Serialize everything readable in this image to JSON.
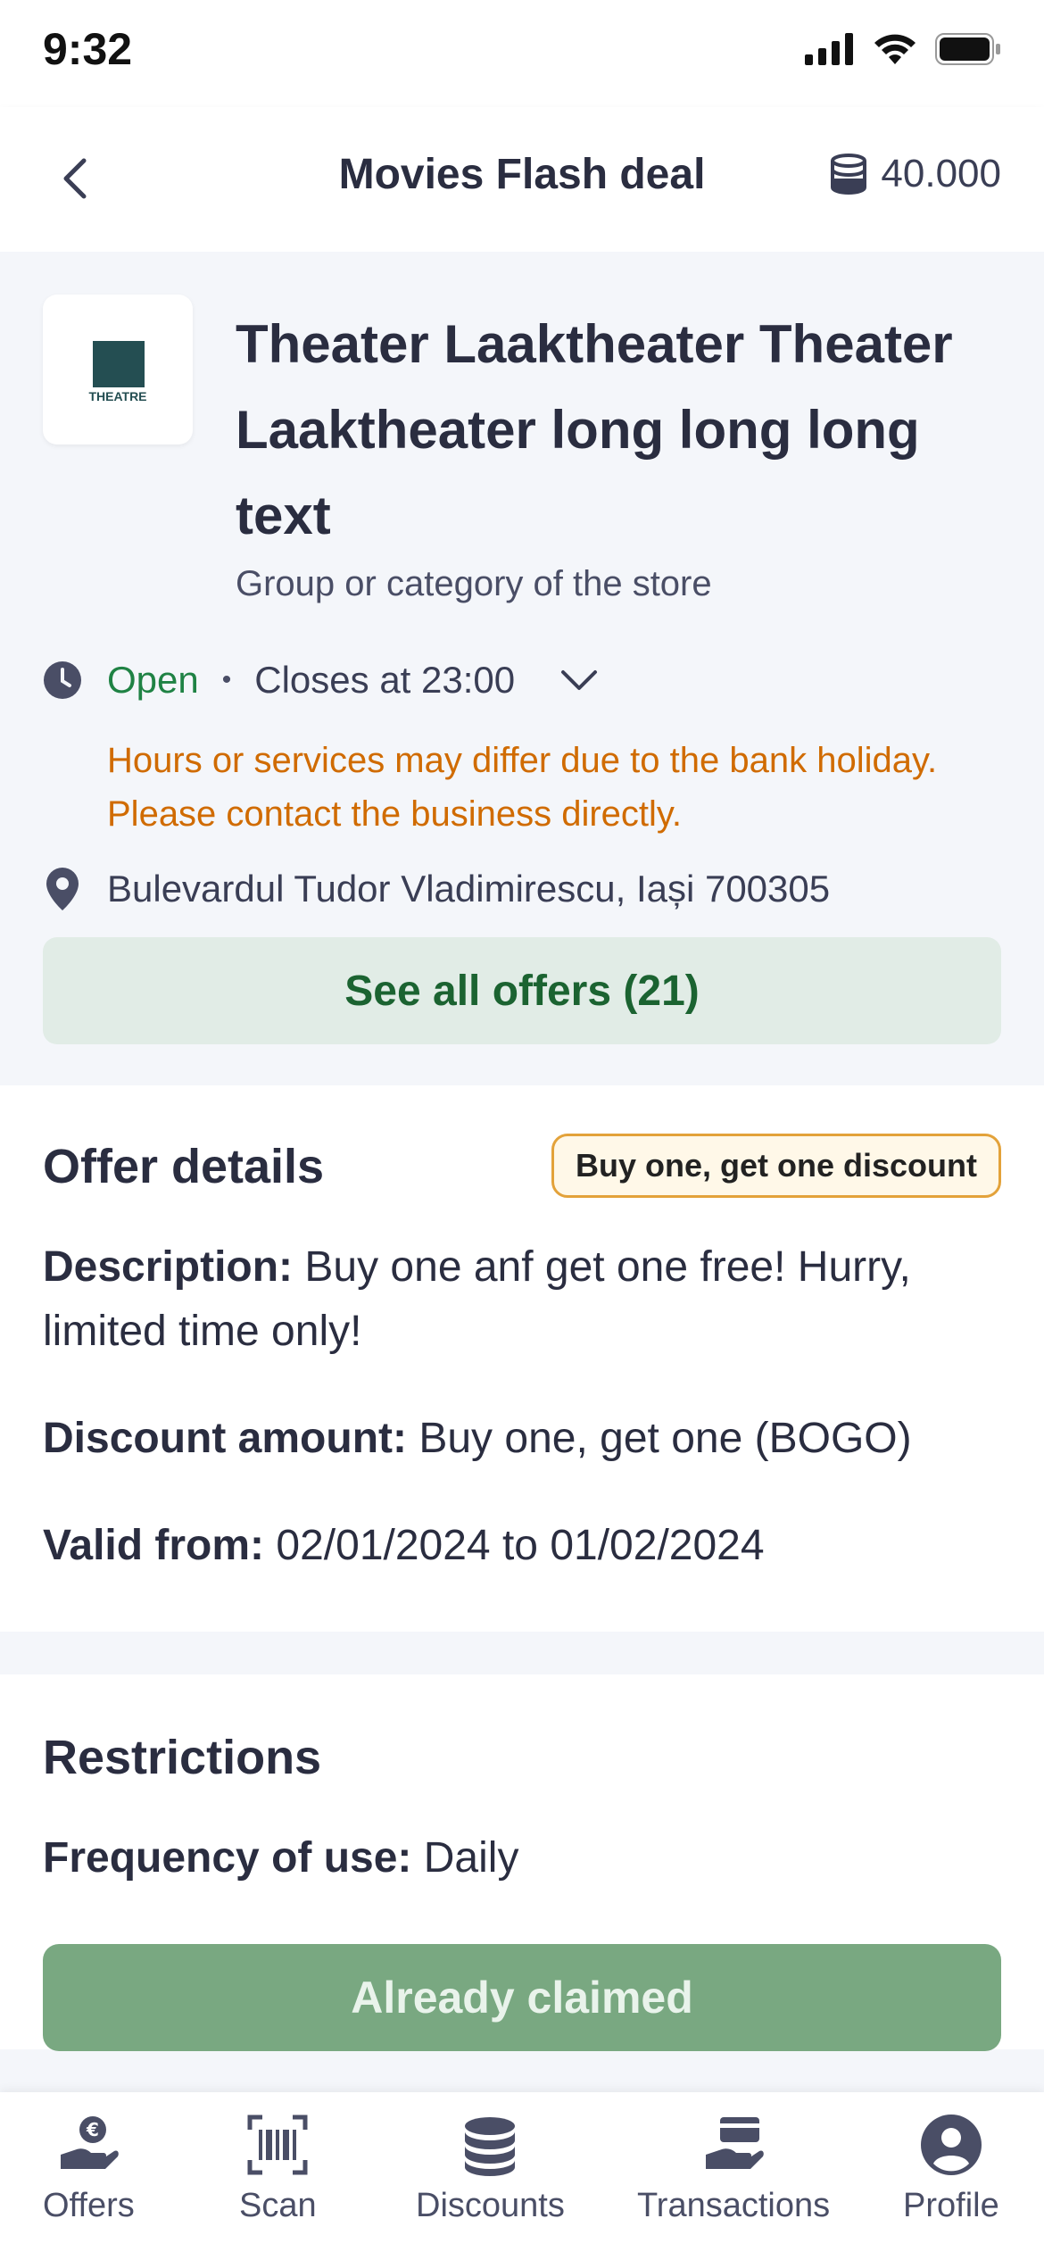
{
  "status_bar": {
    "time": "9:32"
  },
  "header": {
    "title": "Movies Flash deal",
    "coins": "40.000"
  },
  "store": {
    "logo_text": "THEATRE",
    "name": "Theater Laaktheater Theater Laaktheater long long long text",
    "category": "Group or category of the store",
    "open_status": "Open",
    "separator": "•",
    "closes": "Closes at 23:00",
    "holiday_note": "Hours or services may differ due to the bank holiday. Please contact the business directly.",
    "address": "Bulevardul Tudor Vladimirescu, Iași 700305",
    "see_all_label": "See all offers (21)"
  },
  "offer": {
    "heading": "Offer details",
    "badge": "Buy one, get one discount",
    "description_label": "Description:",
    "description": "Buy one anf get one free! Hurry, limited time only!",
    "discount_label": "Discount amount:",
    "discount": "Buy one, get one (BOGO)",
    "valid_label": "Valid from:",
    "valid": "02/01/2024 to 01/02/2024"
  },
  "restrictions": {
    "heading": "Restrictions",
    "frequency_label": "Frequency of use:",
    "frequency": "Daily",
    "claimed_label": "Already claimed"
  },
  "tabbar": {
    "items": [
      {
        "label": "Offers",
        "icon": "hand-euro-icon"
      },
      {
        "label": "Scan",
        "icon": "barcode-scan-icon"
      },
      {
        "label": "Discounts",
        "icon": "coins-stack-icon"
      },
      {
        "label": "Transactions",
        "icon": "hand-card-icon"
      },
      {
        "label": "Profile",
        "icon": "user-circle-icon"
      }
    ]
  },
  "colors": {
    "open_green": "#1f8244",
    "warning_orange": "#d06b00",
    "see_all_bg": "#e1ece6",
    "claimed_bg": "#79a881",
    "badge_border": "#e3a23a"
  }
}
